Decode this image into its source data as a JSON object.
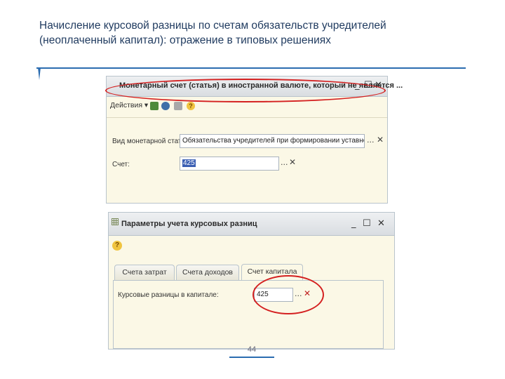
{
  "slide": {
    "title": "Начисление курсовой разницы по счетам обязательств учредителей (неоплаченный капитал): отражение в типовых решениях",
    "page_number": "44"
  },
  "window1": {
    "title": "Монетарный счет (статья) в иностранной валюте, который не является ...",
    "actions_label": "Действия ▾",
    "field1_label": "Вид монетарной статьи:",
    "field1_value": "Обязательства учредителей при формировании уставного капитала",
    "field2_label": "Счет:",
    "field2_value": "425"
  },
  "window2": {
    "title": "Параметры учета курсовых разниц",
    "tabs": [
      {
        "label": "Счета затрат"
      },
      {
        "label": "Счета доходов"
      },
      {
        "label": "Счет капитала"
      }
    ],
    "field_label": "Курсовые разницы в капитале:",
    "field_value": "425"
  },
  "controls": {
    "minimize": "_",
    "maximize": "☐",
    "close": "✕",
    "dots": "...",
    "clear": "✕",
    "help": "?"
  },
  "colors": {
    "title_text": "#1f3a5f",
    "accent_rule": "#2b6cb0",
    "highlight_oval": "#d42020",
    "window_bg": "#fbf8e6"
  },
  "icons": [
    "grid-icon",
    "help-icon",
    "refresh-icon",
    "settings-icon",
    "lock-icon"
  ]
}
